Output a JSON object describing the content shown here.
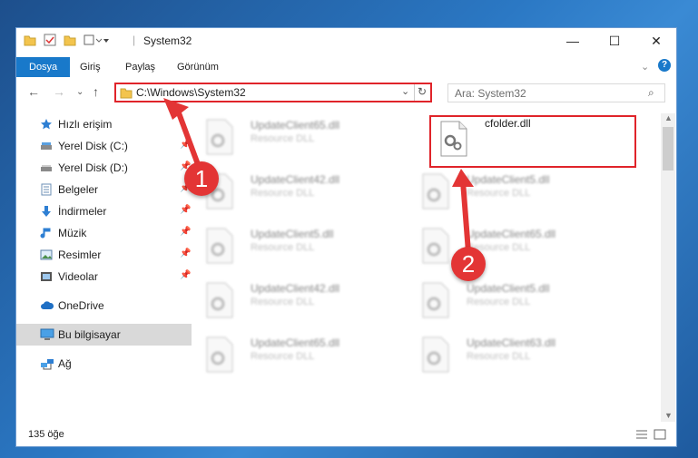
{
  "window": {
    "title": "System32",
    "controls": {
      "minimize": "—",
      "maximize": "☐",
      "close": "✕"
    }
  },
  "ribbon": {
    "tabs": [
      {
        "label": "Dosya",
        "active": true
      },
      {
        "label": "Giriş"
      },
      {
        "label": "Paylaş"
      },
      {
        "label": "Görünüm"
      }
    ]
  },
  "address": {
    "path": "C:\\Windows\\System32",
    "search_placeholder": "Ara: System32"
  },
  "sidebar": {
    "items": [
      {
        "label": "Hızlı erişim",
        "icon": "star-icon",
        "pinned": false
      },
      {
        "label": "Yerel Disk (C:)",
        "icon": "drive-icon",
        "pinned": true
      },
      {
        "label": "Yerel Disk (D:)",
        "icon": "drive-icon",
        "pinned": true
      },
      {
        "label": "Belgeler",
        "icon": "document-icon",
        "pinned": true
      },
      {
        "label": "İndirmeler",
        "icon": "download-icon",
        "pinned": true
      },
      {
        "label": "Müzik",
        "icon": "music-icon",
        "pinned": true
      },
      {
        "label": "Resimler",
        "icon": "picture-icon",
        "pinned": true
      },
      {
        "label": "Videolar",
        "icon": "video-icon",
        "pinned": true
      },
      {
        "label": "OneDrive",
        "icon": "cloud-icon",
        "pinned": false
      },
      {
        "label": "Bu bilgisayar",
        "icon": "computer-icon",
        "pinned": false,
        "selected": true
      },
      {
        "label": "Ağ",
        "icon": "network-icon",
        "pinned": false
      }
    ]
  },
  "files": [
    {
      "name": "UpdateClient65.dll",
      "type": "Resource DLL",
      "blurred": true
    },
    {
      "name": "cfolder.dll",
      "type": "",
      "blurred": false
    },
    {
      "name": "UpdateClient42.dll",
      "type": "Resource DLL",
      "blurred": true
    },
    {
      "name": "UpdateClient5.dll",
      "type": "Resource DLL",
      "blurred": true
    },
    {
      "name": "UpdateClient5.dll",
      "type": "Resource DLL",
      "blurred": true
    },
    {
      "name": "UpdateClient65.dll",
      "type": "Resource DLL",
      "blurred": true
    },
    {
      "name": "UpdateClient42.dll",
      "type": "Resource DLL",
      "blurred": true
    },
    {
      "name": "UpdateClient5.dll",
      "type": "Resource DLL",
      "blurred": true
    },
    {
      "name": "UpdateClient65.dll",
      "type": "Resource DLL",
      "blurred": true
    },
    {
      "name": "UpdateClient63.dll",
      "type": "Resource DLL",
      "blurred": true
    }
  ],
  "status": {
    "count": "135 öğe"
  },
  "markers": {
    "one": "1",
    "two": "2"
  },
  "colors": {
    "accent": "#1979ca",
    "annotation": "#e0242a"
  }
}
